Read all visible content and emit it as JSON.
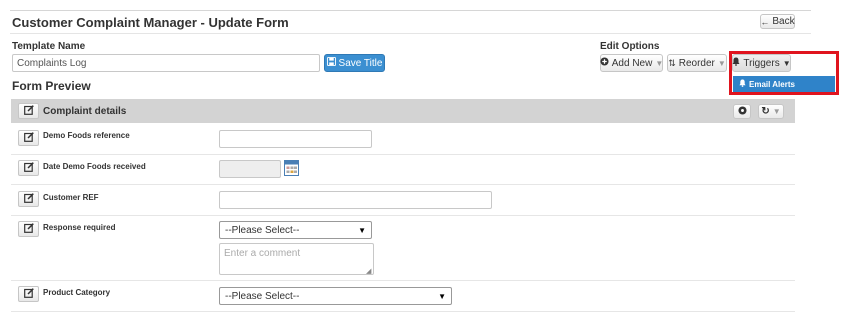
{
  "header": {
    "title": "Customer Complaint Manager - Update Form",
    "back_label": "Back"
  },
  "template": {
    "name_label": "Template Name",
    "name_value": "Complaints Log",
    "save_label": "Save Title"
  },
  "edit_options": {
    "label": "Edit Options",
    "add_new_label": "Add New",
    "reorder_label": "Reorder",
    "triggers_label": "Triggers",
    "dropdown_item": "Email Alerts"
  },
  "form_preview": {
    "title": "Form Preview",
    "section_title": "Complaint details",
    "fields": [
      {
        "label": "Demo Foods reference",
        "type": "text",
        "value": ""
      },
      {
        "label": "Date Demo Foods received",
        "type": "date",
        "value": ""
      },
      {
        "label": "Customer REF",
        "type": "text",
        "value": ""
      },
      {
        "label": "Response required",
        "type": "select",
        "value": "--Please Select--",
        "comment_placeholder": "Enter a comment"
      },
      {
        "label": "Product Category",
        "type": "select",
        "value": "--Please Select--"
      }
    ]
  },
  "icons": {
    "back": "arrow-left-icon",
    "save": "floppy-disk-icon",
    "add": "plus-circle-icon",
    "reorder": "sort-icon",
    "triggers": "bell-icon",
    "edit": "edit-icon",
    "settings": "gear-icon",
    "refresh": "refresh-icon",
    "calendar": "calendar-icon"
  },
  "colors": {
    "primary": "#3b8fd1",
    "highlight": "#e0141e",
    "section_bg": "#d3d3d3"
  }
}
